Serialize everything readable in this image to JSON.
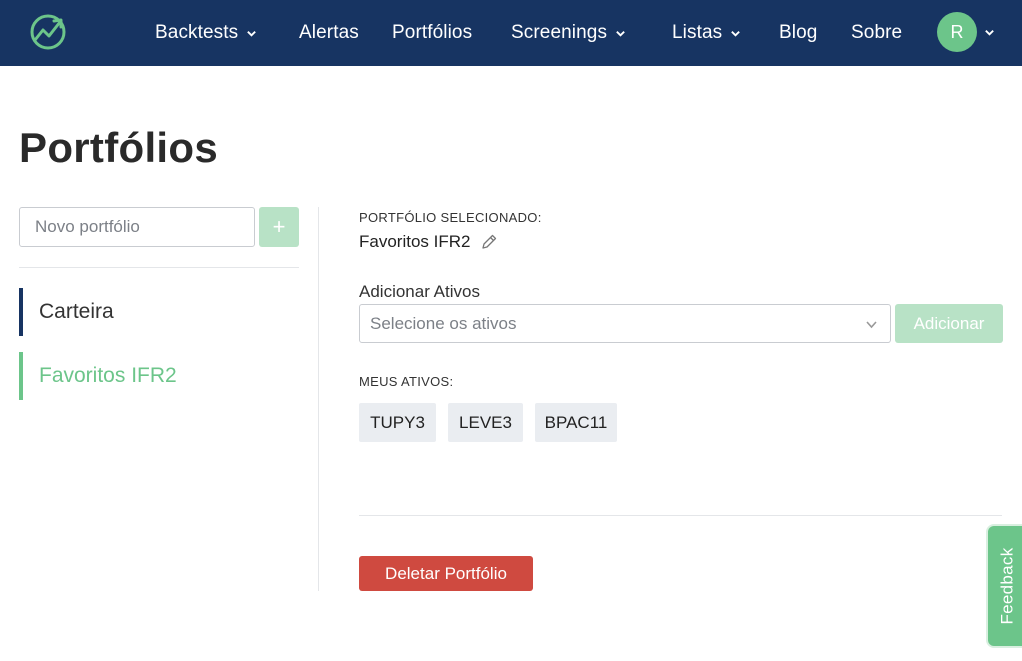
{
  "navbar": {
    "logo_icon": "chart-trend-up-icon",
    "items": [
      {
        "label": "Backtests",
        "has_dropdown": true
      },
      {
        "label": "Alertas",
        "has_dropdown": false
      },
      {
        "label": "Portfólios",
        "has_dropdown": false
      },
      {
        "label": "Screenings",
        "has_dropdown": true
      },
      {
        "label": "Listas",
        "has_dropdown": true
      },
      {
        "label": "Blog",
        "has_dropdown": false
      },
      {
        "label": "Sobre",
        "has_dropdown": false
      }
    ],
    "avatar_initial": "R"
  },
  "page": {
    "title": "Portfólios"
  },
  "sidebar": {
    "new_portfolio_placeholder": "Novo portfólio",
    "add_button_label": "+",
    "portfolios": [
      {
        "label": "Carteira",
        "active": false
      },
      {
        "label": "Favoritos IFR2",
        "active": true
      }
    ]
  },
  "main": {
    "selected_label": "PORTFÓLIO SELECIONADO:",
    "selected_name": "Favoritos IFR2",
    "add_assets_label": "Adicionar Ativos",
    "select_placeholder": "Selecione os ativos",
    "add_button_label": "Adicionar",
    "my_assets_label": "MEUS ATIVOS:",
    "assets": [
      "TUPY3",
      "LEVE3",
      "BPAC11"
    ],
    "delete_button_label": "Deletar Portfólio"
  },
  "feedback": {
    "label": "Feedback"
  },
  "colors": {
    "navbar_bg": "#173462",
    "accent_green": "#6cc58a",
    "disabled_green": "#b8e2c6",
    "danger_red": "#cf4a40"
  }
}
